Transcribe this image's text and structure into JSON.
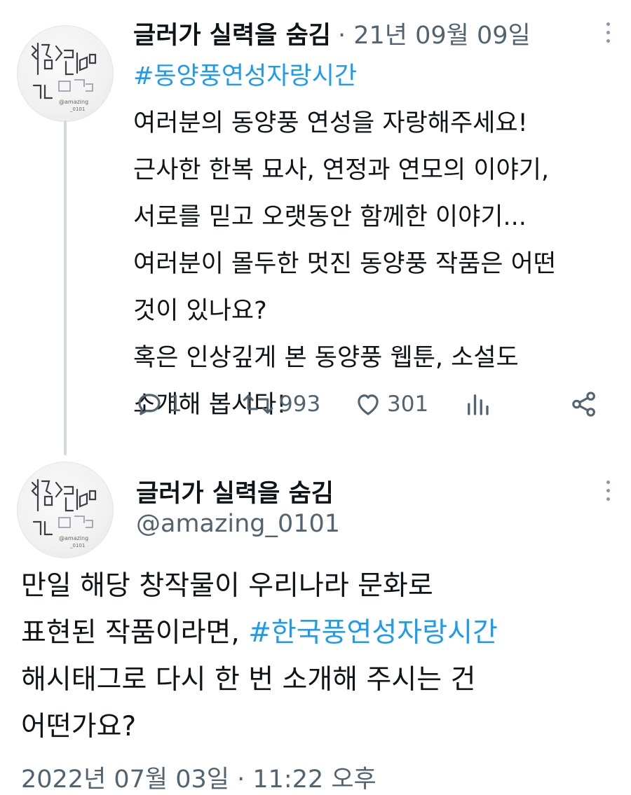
{
  "tweet1": {
    "author_name": "글러가 실력을 숨김",
    "date": "· 21년 09월 09일",
    "hashtag": "#동양풍연성자랑시간",
    "lines": [
      "여러분의 동양풍 연성을 자랑해주세요!",
      "근사한 한복 묘사, 연정과 연모의 이야기,",
      "서로를 믿고 오랫동안 함께한 이야기...",
      "여러분이 몰두한 멋진 동양풍 작품은 어떤",
      "것이 있나요?",
      "혹은 인상깊게 본 동양풍 웹툰, 소설도",
      "소개해 봅시다!"
    ],
    "actions": {
      "reply_count": "1",
      "retweet_count": "993",
      "like_count": "301"
    },
    "icons": {
      "reply": "reply-icon",
      "retweet": "retweet-icon",
      "like": "heart-icon",
      "stats": "analytics-icon",
      "share": "share-icon",
      "more": "more-vertical-icon"
    }
  },
  "tweet2": {
    "author_name": "글러가 실력을 숨김",
    "handle": "@amazing_0101",
    "line1": "만일 해당 창작물이 우리나라 문화로",
    "line2_text": "표현된 작품이라면, ",
    "line2_hashtag": "#한국풍연성자랑시간",
    "line3": "해시태그로 다시 한 번 소개해 주시는 건",
    "line4": "어떤가요?",
    "timestamp": "2022년 07월 03일 · 11:22 오후"
  },
  "colors": {
    "text": "#0f1419",
    "secondary": "#536471",
    "hashtag": "#1d9bf0",
    "thread_line": "#cfd9de"
  }
}
